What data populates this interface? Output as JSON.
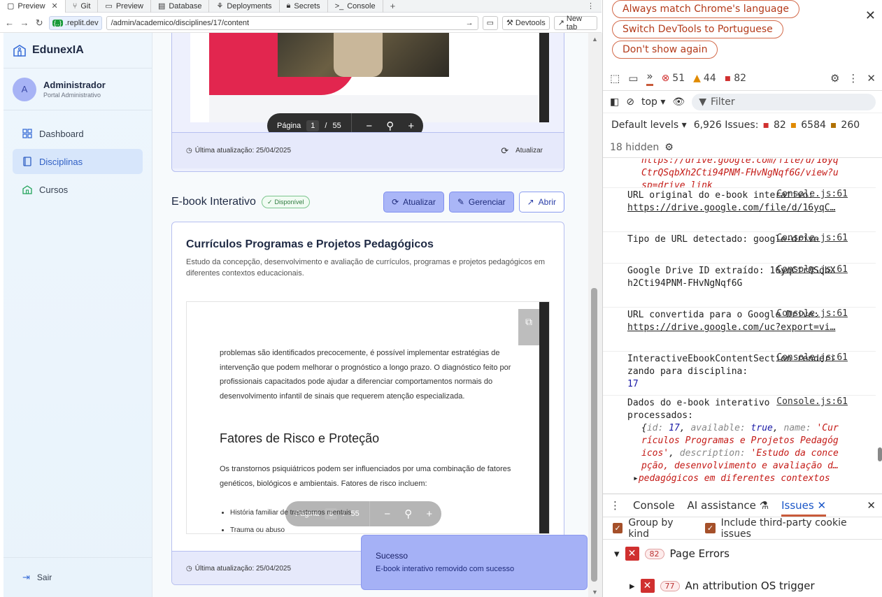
{
  "browser": {
    "tabs": [
      {
        "label": "Preview",
        "active": true
      },
      {
        "label": "Git"
      },
      {
        "label": "Preview"
      },
      {
        "label": "Database"
      },
      {
        "label": "Deployments"
      },
      {
        "label": "Secrets"
      },
      {
        "label": "Console"
      }
    ],
    "site_label": ".replit.dev",
    "url": "/admin/academico/disciplines/17/content",
    "devtools_btn": "Devtools",
    "newtab_btn": "New tab"
  },
  "sidebar": {
    "brand": "EdunexIA",
    "user": {
      "initial": "A",
      "name": "Administrador",
      "role": "Portal Administrativo"
    },
    "items": [
      {
        "label": "Dashboard",
        "active": false
      },
      {
        "label": "Disciplinas",
        "active": true
      },
      {
        "label": "Cursos",
        "active": false
      }
    ],
    "logout": "Sair"
  },
  "top_card": {
    "pager": {
      "label": "Página",
      "page": "1",
      "sep": "/",
      "total": "55"
    },
    "updated": "Última atualização: 25/04/2025",
    "refresh": "Atualizar"
  },
  "ebook": {
    "section_title": "E-book Interativo",
    "badge": "Disponível",
    "btn_update": "Atualizar",
    "btn_manage": "Gerenciar",
    "btn_open": "Abrir",
    "title": "Currículos Programas e Projetos Pedagógicos",
    "description": "Estudo da concepção, desenvolvimento e avaliação de currículos, programas e projetos pedagógicos em diferentes contextos educacionais.",
    "doc": {
      "para1": "problemas são identificados precocemente, é possível implementar estratégias de intervenção que podem melhorar o prognóstico a longo prazo. O diagnóstico feito por profissionais capacitados pode ajudar a diferenciar comportamentos normais do desenvolvimento infantil de sinais que requerem atenção especializada.",
      "heading": "Fatores de Risco e Proteção",
      "para2": "Os transtornos psiquiátricos podem ser influenciados por uma combinação de fatores genéticos, biológicos e ambientais. Fatores de risco incluem:",
      "bullets": [
        "História familiar de transtornos mentais",
        "Trauma ou abuso"
      ]
    },
    "pager": {
      "label": "Página",
      "page": "6",
      "sep": "/",
      "total": "55"
    },
    "updated": "Última atualização: 25/04/2025"
  },
  "toast": {
    "title": "Sucesso",
    "message": "E-book interativo removido com sucesso"
  },
  "devtools": {
    "infobar": [
      "Always match Chrome's language",
      "Switch DevTools to Portuguese",
      "Don't show again"
    ],
    "counts": {
      "errors": "51",
      "warnings": "44",
      "issues": "82"
    },
    "context": "top",
    "filter_placeholder": "Filter",
    "levels": "Default levels",
    "issues_summary": {
      "label": "6,926 Issues:",
      "errors": "82",
      "warnings": "6584",
      "info": "260"
    },
    "hidden": "18 hidden",
    "console": {
      "src": "Console.js:61",
      "top_fragment_url": "https://drive.google.com/file/d/16yqCtrQSqbXh2Cti94PNM-FHvNgNqf6G/view?usp=drive_link",
      "rows": [
        {
          "text": "URL original do e-book interativo:",
          "link": "https://drive.google.com/file/d/16yqC…"
        },
        {
          "text": "Tipo de URL detectado: google-drive"
        },
        {
          "text": "Google Drive ID extraído: 16yqCtrQSqbXh2Cti94PNM-FHvNgNqf6G"
        },
        {
          "text": "URL convertida para o Google Drive:",
          "link": "https://drive.google.com/uc?export=vi…"
        },
        {
          "text": "InteractiveEbookContentSection renderizando para disciplina:",
          "value": "17"
        },
        {
          "text": "Dados do e-book interativo processados:"
        }
      ],
      "obj": {
        "id": "17",
        "available": "true",
        "name": "'Currículos Programas e Projetos Pedagógicos'",
        "description": "'Estudo da concepção, desenvolvimento e avaliação d…",
        "tail": "pedagógicos em diferentes contextos"
      }
    },
    "drawer_tabs": [
      "Console",
      "AI assistance",
      "Issues"
    ],
    "group_by_kind": "Group by kind",
    "third_party": "Include third-party cookie issues",
    "page_errors": {
      "count": "82",
      "label": "Page Errors"
    },
    "attribution": {
      "count": "77",
      "label": "An attribution OS trigger"
    }
  }
}
